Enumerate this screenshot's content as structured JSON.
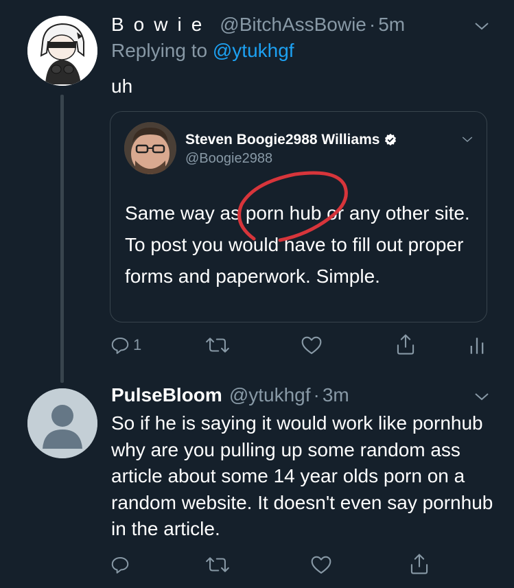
{
  "tweet1": {
    "display_name": "Bowie",
    "handle": "@BitchAssBowie",
    "separator": "·",
    "time": "5m",
    "replying_prefix": "Replying to",
    "replying_to": "@ytukhgf",
    "text": "uh",
    "actions": {
      "reply_count": "1"
    }
  },
  "quote": {
    "display_name": "Steven Boogie2988 Williams",
    "handle": "@Boogie2988",
    "text": "Same way as porn hub or any other site.  To post you would have to fill out proper forms and paperwork. Simple."
  },
  "tweet2": {
    "display_name": "PulseBloom",
    "handle": "@ytukhgf",
    "separator": "·",
    "time": "3m",
    "text": "So if he is saying it would work like pornhub why are you pulling up some random ass article about some 14 year olds porn on a random website. It doesn't even say pornhub in the article."
  },
  "colors": {
    "background": "#15202b",
    "secondary_text": "#8899a6",
    "link": "#1da1f2",
    "border": "#38444d",
    "annotation_circle": "#d7353b"
  },
  "icons": [
    "chevron-down-icon",
    "verified-badge-icon",
    "reply-icon",
    "retweet-icon",
    "like-icon",
    "share-icon",
    "analytics-icon"
  ]
}
